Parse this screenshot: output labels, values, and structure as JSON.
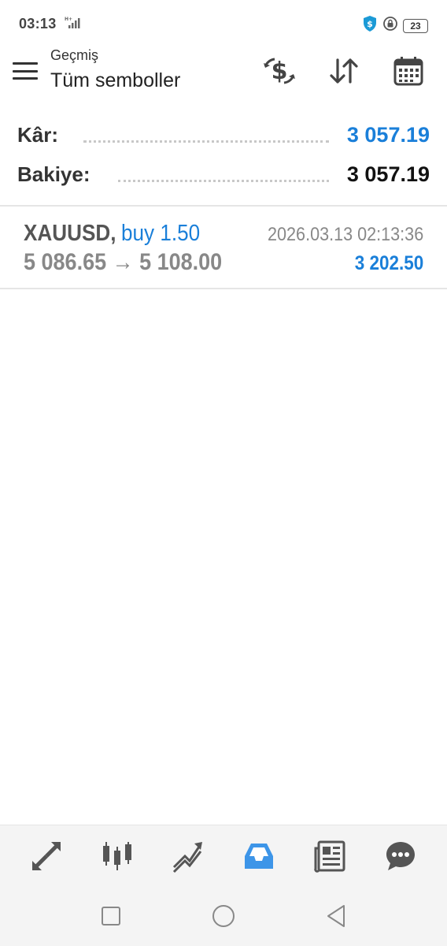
{
  "status_bar": {
    "time": "03:13",
    "battery": "23"
  },
  "header": {
    "subtitle": "Geçmiş",
    "title": "Tüm semboller"
  },
  "summary": {
    "profit_label": "Kâr:",
    "profit_value": "3 057.19",
    "balance_label": "Bakiye:",
    "balance_value": "3 057.19"
  },
  "deals": [
    {
      "symbol": "XAUUSD,",
      "type": "buy 1.50",
      "time": "2026.03.13 02:13:36",
      "prices": "5 086.65 → 5 108.00",
      "profit": "3 202.50"
    }
  ],
  "colors": {
    "accent": "#1a7fd9",
    "nav_active": "#3d95e8",
    "nav_inactive": "#555555"
  },
  "icons": {
    "menu": "menu-icon",
    "currency_exchange": "currency-exchange-icon",
    "sort": "sort-icon",
    "calendar": "calendar-icon",
    "nav": [
      "quotes-icon",
      "chart-icon",
      "trade-icon",
      "history-icon",
      "news-icon",
      "chat-icon"
    ]
  }
}
